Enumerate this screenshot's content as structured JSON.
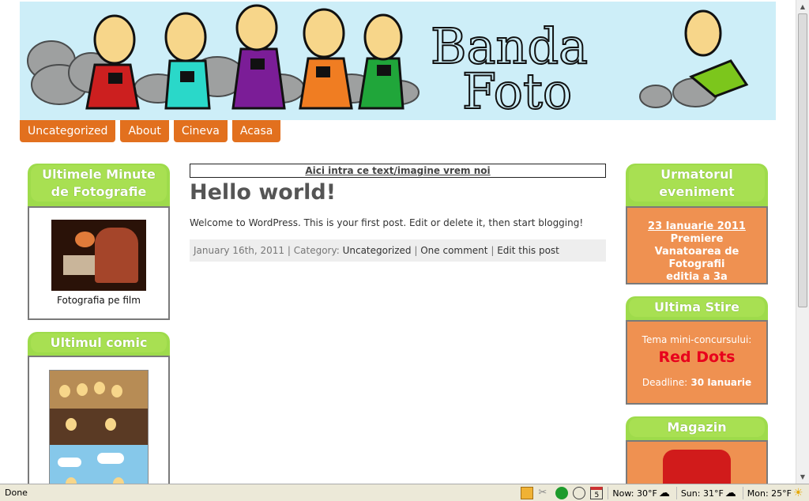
{
  "banner": {
    "title_line1": "Banda",
    "title_line2": "Foto"
  },
  "nav": {
    "items": [
      "Uncategorized",
      "About",
      "Cineva",
      "Acasa"
    ]
  },
  "left_sidebar": {
    "widget1": {
      "title": "Ultimele Minute de Fotografie",
      "caption": "Fotografia pe film"
    },
    "widget2": {
      "title": "Ultimul comic"
    }
  },
  "main": {
    "ad_text": "Aici intra ce text/imagine vrem noi",
    "post_title": "Hello world!",
    "post_body": "Welcome to WordPress. This is your first post. Edit or delete it, then start blogging!",
    "meta": {
      "date": "January 16th, 2011",
      "category_label": "Category:",
      "category": "Uncategorized",
      "comments": "One comment",
      "edit": "Edit this post",
      "sep": "|"
    }
  },
  "right_sidebar": {
    "widget1": {
      "title": "Urmatorul eveniment",
      "date": "23 Ianuarie 2011",
      "line1": "Premiere",
      "line2": "Vanatoarea de Fotografii",
      "line3": "editia a 3a"
    },
    "widget2": {
      "title": "Ultima Stire",
      "intro": "Tema mini-concursului:",
      "highlight": "Red Dots",
      "deadline_label": "Deadline:",
      "deadline": "30 Ianuarie"
    },
    "widget3": {
      "title": "Magazin"
    }
  },
  "statusbar": {
    "status": "Done",
    "weather": [
      {
        "label": "Now: 30°F"
      },
      {
        "label": "Sun: 31°F"
      },
      {
        "label": "Mon: 25°F"
      }
    ],
    "calendar_day": "5"
  },
  "colors": {
    "nav_orange": "#e2701e",
    "widget_green": "#9edb4b",
    "widget_orange": "#ef9151",
    "banner_sky": "#cdeef8",
    "red_highlight": "#e8001c"
  }
}
